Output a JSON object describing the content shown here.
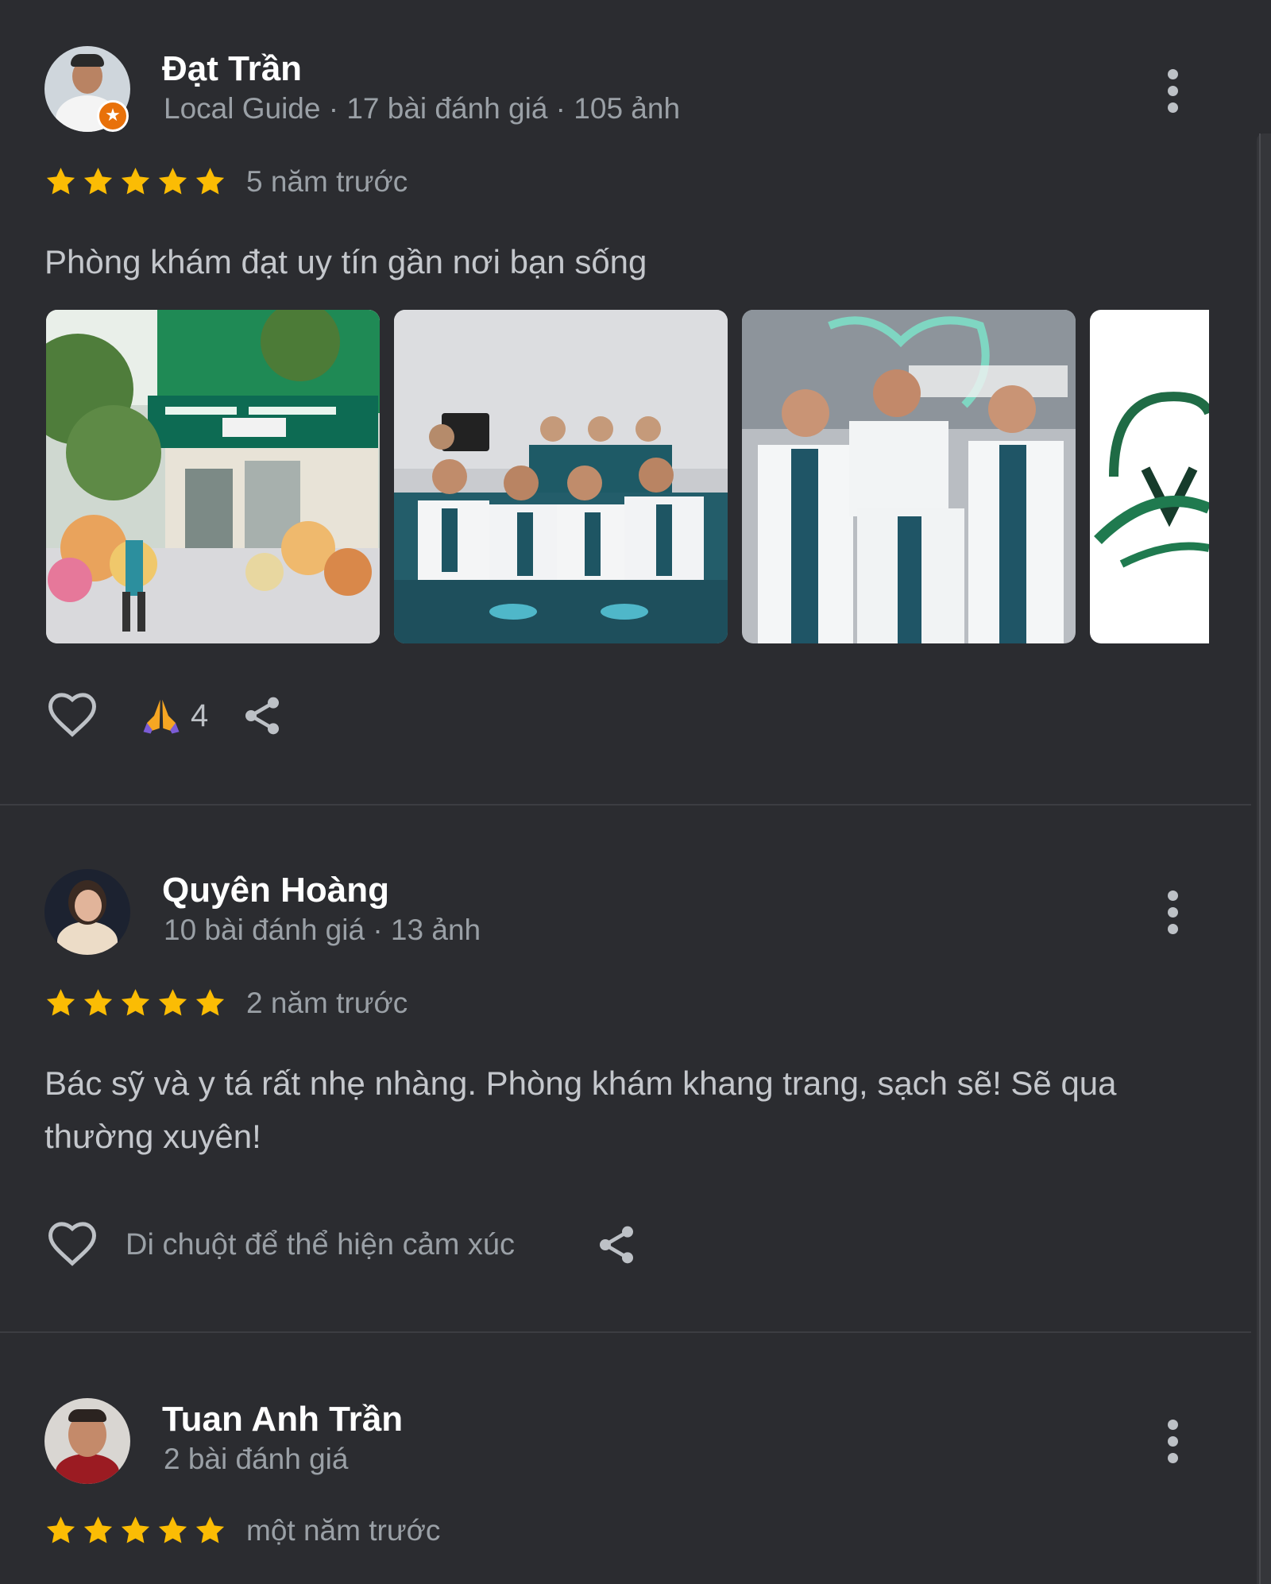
{
  "colors": {
    "background": "#2b2c30",
    "star": "#fbbc04",
    "muted_text": "#9aa0a6",
    "local_guide_badge": "#e8710a"
  },
  "reviews": [
    {
      "author": "Đạt Trần",
      "meta": "Local Guide · 17 bài đánh giá · 105 ảnh",
      "rating": 5,
      "time": "5 năm trước",
      "text": "Phòng khám đạt uy tín gần nơi bạn sống",
      "photos": [
        "clinic-storefront",
        "dental-team-group",
        "doctors-in-white-coats",
        "dental-logo"
      ],
      "reaction_emoji": "🙏",
      "reaction_count": "4",
      "icons": [
        "heart-outline-icon",
        "pray-emoji-icon",
        "share-icon",
        "more-vert-icon",
        "local-guide-star-icon"
      ]
    },
    {
      "author": "Quyên Hoàng",
      "meta": "10 bài đánh giá · 13 ảnh",
      "rating": 5,
      "time": "2 năm trước",
      "text": "Bác sỹ và y tá rất nhẹ nhàng. Phòng khám khang trang, sạch sẽ! Sẽ qua thường xuyên!",
      "reaction_hint": "Di chuột để thể hiện cảm xúc",
      "icons": [
        "heart-outline-icon",
        "share-icon",
        "more-vert-icon"
      ]
    },
    {
      "author": "Tuan Anh Trần",
      "meta": "2 bài đánh giá",
      "rating": 5,
      "time": "một năm trước",
      "icons": [
        "more-vert-icon"
      ]
    }
  ]
}
